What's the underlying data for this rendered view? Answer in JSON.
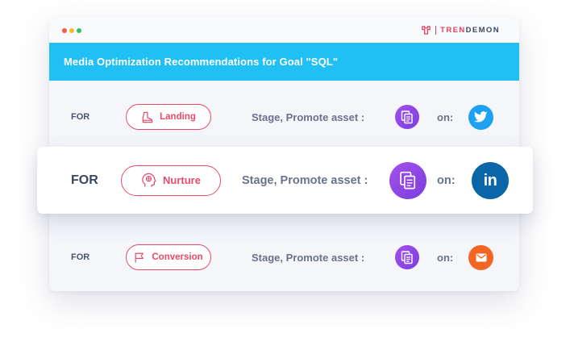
{
  "window": {
    "dot_colors": [
      "#f25a4a",
      "#f7b82b",
      "#2fc35a"
    ],
    "brand": {
      "part1": "TREN",
      "part2": "DEMON",
      "color": "#e2405e"
    }
  },
  "header": {
    "title": "Media Optimization Recommendations for Goal \"SQL\"",
    "bg_color": "#20c0f5"
  },
  "rows": [
    {
      "for_label": "FOR",
      "stage": "Landing",
      "stage_icon": "boot-icon",
      "promote_label": "Stage, Promote asset :",
      "asset_icon": "document-copy-icon",
      "on_label": "on:",
      "channel": "twitter",
      "channel_icon": "twitter-icon",
      "channel_color": "#1da1f2"
    },
    {
      "for_label": "FOR",
      "stage": "Nurture",
      "stage_icon": "head-brain-icon",
      "promote_label": "Stage, Promote asset :",
      "asset_icon": "document-copy-icon",
      "on_label": "on:",
      "channel": "linkedin",
      "channel_icon": "linkedin-icon",
      "channel_label": "in",
      "channel_color": "#0a66a8",
      "highlighted": true
    },
    {
      "for_label": "FOR",
      "stage": "Conversion",
      "stage_icon": "flag-icon",
      "promote_label": "Stage, Promote asset :",
      "asset_icon": "document-copy-icon",
      "on_label": "on:",
      "channel": "email",
      "channel_icon": "email-icon",
      "channel_color": "#f26522"
    }
  ],
  "colors": {
    "pill_accent": "#e94a6a",
    "asset_purple": "#8f46e6"
  }
}
